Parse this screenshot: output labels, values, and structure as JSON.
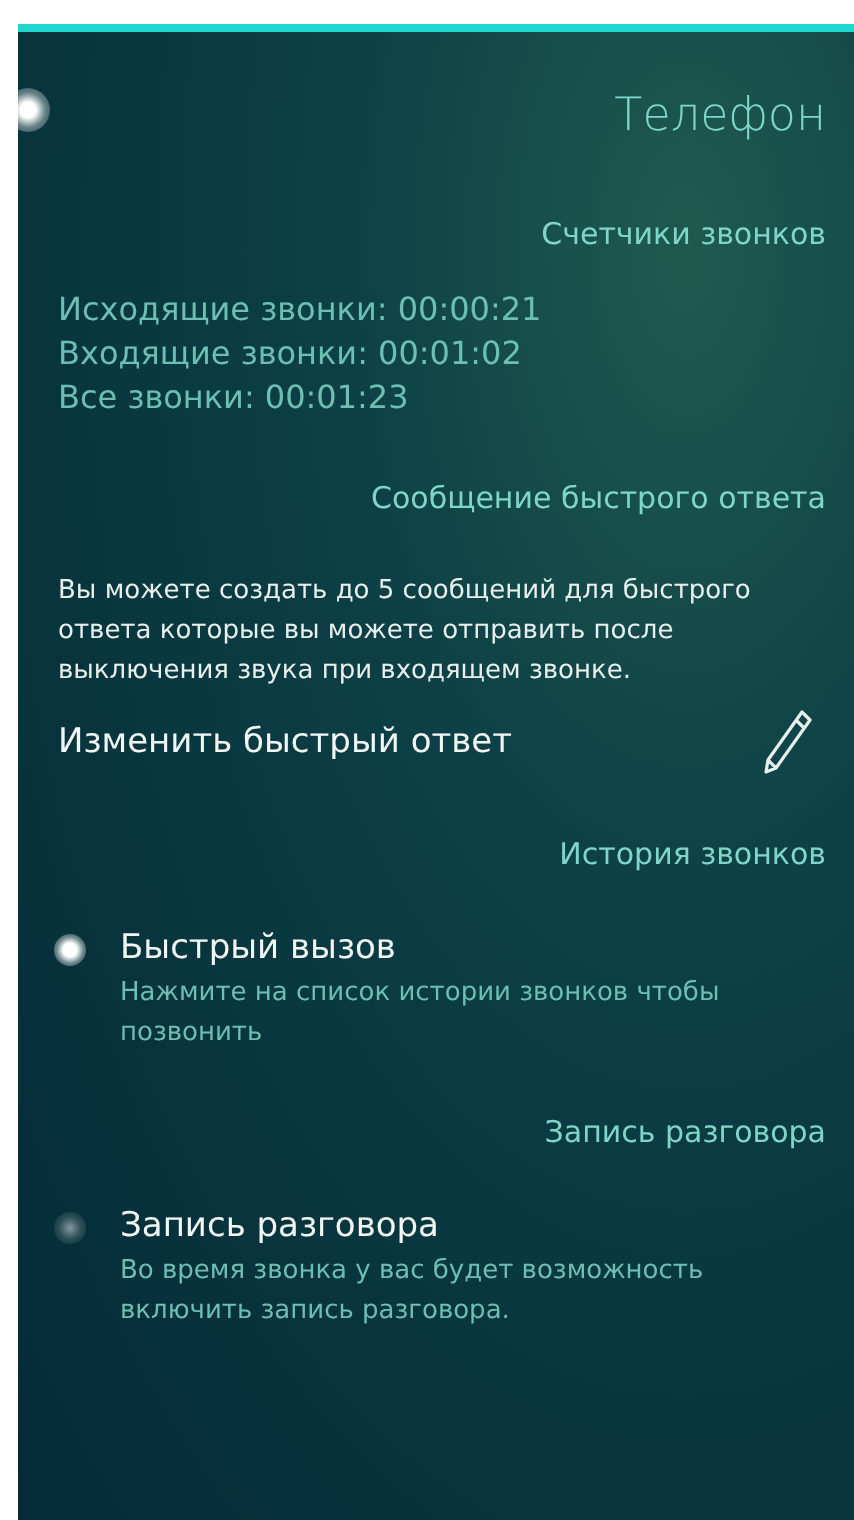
{
  "page": {
    "title": "Телефон"
  },
  "sections": [
    {
      "kind": "counters",
      "header": "Счетчики звонков",
      "lines": [
        "Исходящие звонки: 00:00:21",
        "Входящие звонки: 00:01:02",
        "Все звонки: 00:01:23"
      ]
    },
    {
      "kind": "quick_reply",
      "header": "Сообщение быстрого ответа",
      "description": "Вы можете создать до 5 сообщений для быстрого ответа которые вы можете отправить после выключения звука при входящем звонке.",
      "action": "Изменить быстрый ответ"
    },
    {
      "kind": "switch",
      "header": "История звонков",
      "label": "Быстрый вызов",
      "description": "Нажмите на список истории звонков чтобы позвонить",
      "on": true
    },
    {
      "kind": "switch",
      "header": "Запись разговора",
      "label": "Запись разговора",
      "description": "Во время звонка у вас будет возможность включить запись разговора.",
      "on": false
    }
  ]
}
